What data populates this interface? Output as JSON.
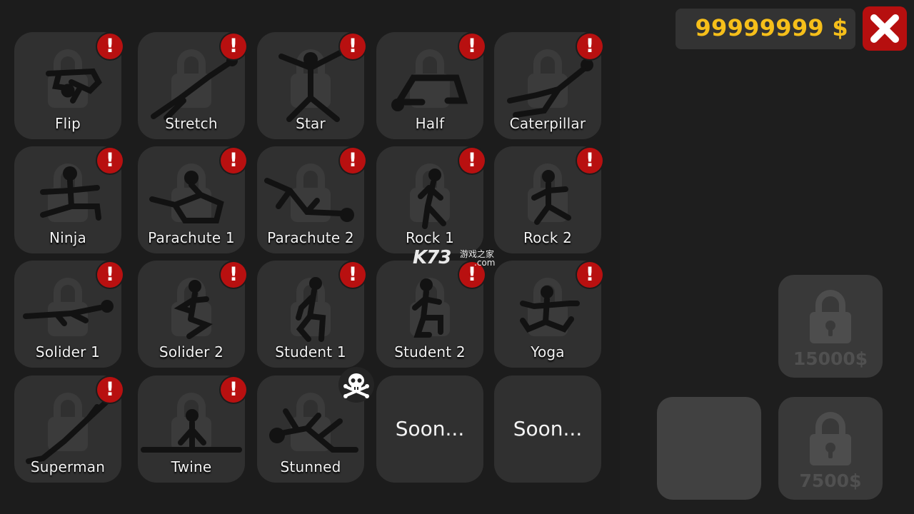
{
  "header": {
    "money": "99999999 $",
    "close_icon": "close-x-icon"
  },
  "colors": {
    "background": "#1c1c1c",
    "tile": "#303030",
    "badge": "#b81010",
    "money_text": "#f6bf1a",
    "close_button": "#b60f0f",
    "locked_price_text": "#505050"
  },
  "poses": {
    "items": [
      {
        "label": "Flip",
        "badge": "!"
      },
      {
        "label": "Stretch",
        "badge": "!"
      },
      {
        "label": "Star",
        "badge": "!"
      },
      {
        "label": "Half",
        "badge": "!"
      },
      {
        "label": "Caterpillar",
        "badge": "!"
      },
      {
        "label": "Ninja",
        "badge": "!"
      },
      {
        "label": "Parachute 1",
        "badge": "!"
      },
      {
        "label": "Parachute 2",
        "badge": "!"
      },
      {
        "label": "Rock 1",
        "badge": "!"
      },
      {
        "label": "Rock 2",
        "badge": "!"
      },
      {
        "label": "Solider 1",
        "badge": "!"
      },
      {
        "label": "Solider 2",
        "badge": "!"
      },
      {
        "label": "Student 1",
        "badge": "!"
      },
      {
        "label": "Student 2",
        "badge": "!"
      },
      {
        "label": "Yoga",
        "badge": "!"
      },
      {
        "label": "Superman",
        "badge": "!"
      },
      {
        "label": "Twine",
        "badge": "!"
      },
      {
        "label": "Stunned",
        "badge_icon": "skull-crossbones-icon"
      },
      {
        "label": "Soon..."
      },
      {
        "label": "Soon..."
      }
    ]
  },
  "shop": {
    "slot_top_price": "15000$",
    "slot_bottom_price": "7500$",
    "slot_icon": "padlock-icon"
  },
  "watermark": {
    "logo": "K73",
    "cn": "游戏之家",
    "com": ".com"
  }
}
